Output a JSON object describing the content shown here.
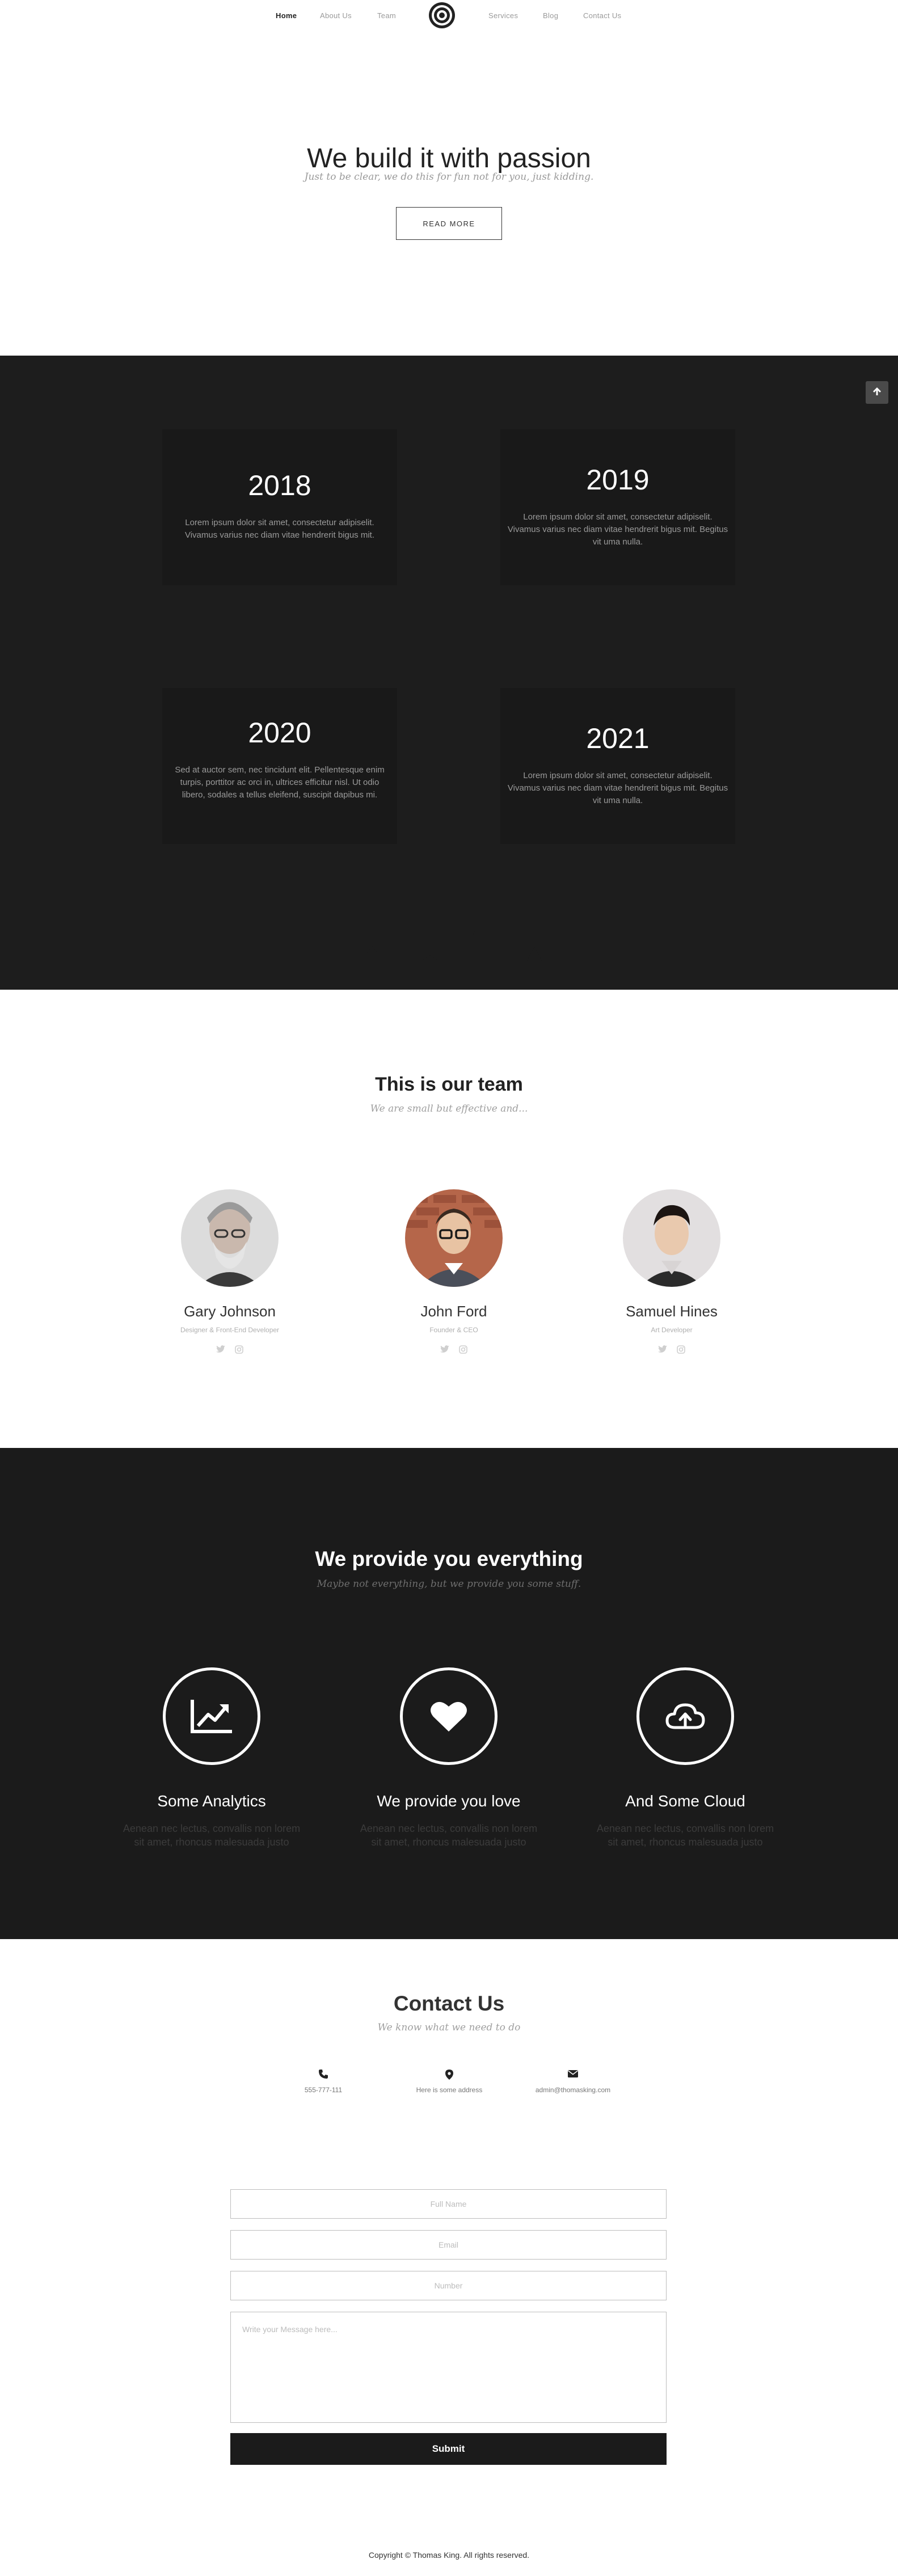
{
  "nav": {
    "items": [
      {
        "label": "Home",
        "active": true
      },
      {
        "label": "About Us",
        "active": false
      },
      {
        "label": "Team",
        "active": false
      },
      {
        "label": "Services",
        "active": false
      },
      {
        "label": "Blog",
        "active": false
      },
      {
        "label": "Contact Us",
        "active": false
      }
    ],
    "logo_icon": "target-icon"
  },
  "hero": {
    "title": "We build it with passion",
    "subtitle": "Just to be clear, we do this for fun not for you, just kidding.",
    "button_label": "READ MORE"
  },
  "timeline": {
    "cards": [
      {
        "year": "2018",
        "text": "Lorem ipsum dolor sit amet, consectetur adipiselit. Vivamus varius nec diam vitae hendrerit bigus mit."
      },
      {
        "year": "2019",
        "text": "Lorem ipsum dolor sit amet, consectetur adipiselit. Vivamus varius nec diam vitae hendrerit bigus mit. Begitus vit uma nulla."
      },
      {
        "year": "2020",
        "text": "Sed at auctor sem, nec tincidunt elit. Pellentesque enim turpis, porttitor ac orci in, ultrices efficitur nisl. Ut odio libero, sodales a tellus eleifend, suscipit dapibus mi."
      },
      {
        "year": "2021",
        "text": "Lorem ipsum dolor sit amet, consectetur adipiselit. Vivamus varius nec diam vitae hendrerit bigus mit. Begitus vit uma nulla."
      }
    ],
    "back_to_top_icon": "arrow-up-icon"
  },
  "team": {
    "title": "This is our team",
    "subtitle": "We are small but effective and...",
    "members": [
      {
        "name": "Gary Johnson",
        "role": "Designer & Front-End Developer"
      },
      {
        "name": "John Ford",
        "role": "Founder & CEO"
      },
      {
        "name": "Samuel Hines",
        "role": "Art Developer"
      }
    ],
    "social_icons": [
      "twitter-icon",
      "instagram-icon"
    ]
  },
  "services": {
    "title": "We provide you everything",
    "subtitle": "Maybe not everything, but we provide you some stuff.",
    "items": [
      {
        "name": "Some Analytics",
        "desc": "Aenean nec lectus, convallis non lorem sit amet, rhoncus malesuada justo",
        "icon": "chart-icon"
      },
      {
        "name": "We provide you love",
        "desc": "Aenean nec lectus, convallis non lorem sit amet, rhoncus malesuada justo",
        "icon": "heart-icon"
      },
      {
        "name": "And Some Cloud",
        "desc": "Aenean nec lectus, convallis non lorem sit amet, rhoncus malesuada justo",
        "icon": "cloud-upload-icon"
      }
    ]
  },
  "contact": {
    "title": "Contact Us",
    "subtitle": "We know what we need to do",
    "info": [
      {
        "value": "555-777-111",
        "icon": "phone-icon"
      },
      {
        "value": "Here is some address",
        "icon": "map-pin-icon"
      },
      {
        "value": "admin@thomasking.com",
        "icon": "envelope-icon"
      }
    ],
    "form": {
      "name_placeholder": "Full Name",
      "email_placeholder": "Email",
      "number_placeholder": "Number",
      "message_placeholder": "Write your Message here...",
      "submit_label": "Submit"
    }
  },
  "footer": {
    "copyright": "Copyright © Thomas King.  All rights reserved."
  }
}
